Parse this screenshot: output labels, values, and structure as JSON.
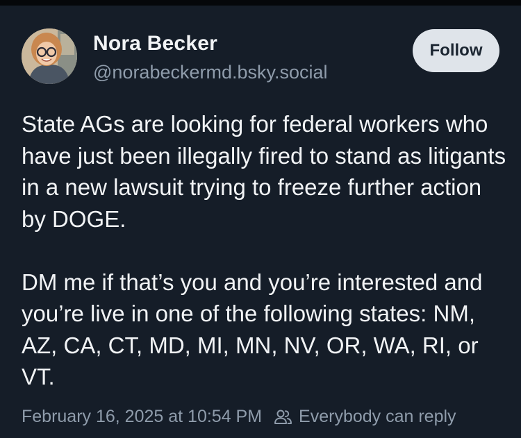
{
  "author": {
    "display_name": "Nora Becker",
    "handle": "@norabeckermd.bsky.social"
  },
  "follow_button": {
    "label": "Follow"
  },
  "post": {
    "paragraphs": [
      "State AGs are looking for federal workers who have just been illegally fired to stand as litigants in a new lawsuit trying to freeze further action by DOGE.",
      "DM me if that’s you and you’re interested and you’re live in one of the following states: NM, AZ, CA, CT, MD, MI, MN, NV, OR, WA, RI, or VT."
    ],
    "timestamp": "February 16, 2025 at 10:54 PM",
    "reply_setting": "Everybody can reply"
  },
  "icons": {
    "avatar": "profile-photo",
    "reply_setting": "people-icon"
  },
  "colors": {
    "background": "#151d28",
    "primary_text": "#f1f3f5",
    "secondary_text": "#8f9cab",
    "follow_button_bg": "#dfe4ea"
  }
}
